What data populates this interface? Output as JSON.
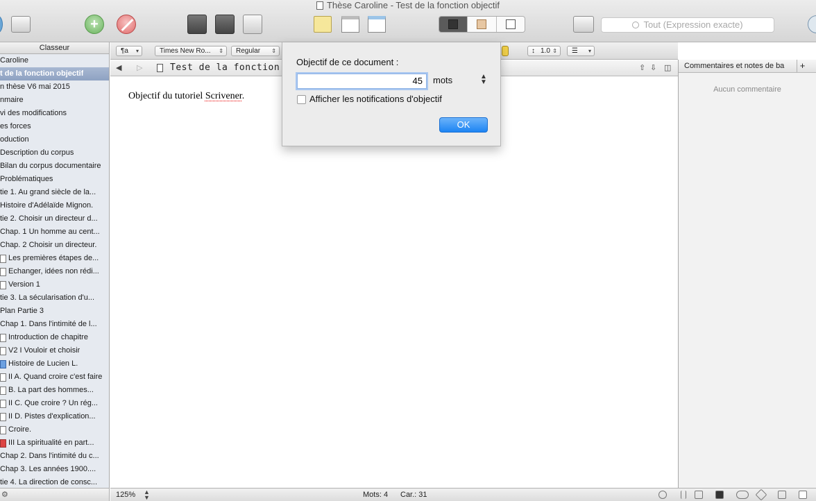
{
  "window": {
    "title": "Thèse Caroline - Test de la fonction objectif"
  },
  "toolbar": {
    "search_placeholder": "Tout (Expression exacte)"
  },
  "binder": {
    "header": "Classeur",
    "items": [
      {
        "label": "Caroline",
        "selected": false,
        "icon": "none"
      },
      {
        "label": "t de la fonction objectif",
        "selected": true,
        "icon": "none"
      },
      {
        "label": "n thèse V6 mai 2015",
        "selected": false,
        "icon": "none"
      },
      {
        "label": "nmaire",
        "selected": false,
        "icon": "none"
      },
      {
        "label": "vi des modifications",
        "selected": false,
        "icon": "none"
      },
      {
        "label": "es forces",
        "selected": false,
        "icon": "none"
      },
      {
        "label": "oduction",
        "selected": false,
        "icon": "none"
      },
      {
        "label": "Description du corpus",
        "selected": false,
        "icon": "none"
      },
      {
        "label": "Bilan du corpus documentaire",
        "selected": false,
        "icon": "none"
      },
      {
        "label": "Problématiques",
        "selected": false,
        "icon": "none"
      },
      {
        "label": "tie 1. Au grand siècle de la...",
        "selected": false,
        "icon": "none"
      },
      {
        "label": "Histoire d'Adélaïde Mignon.",
        "selected": false,
        "icon": "none"
      },
      {
        "label": "tie 2. Choisir un directeur d...",
        "selected": false,
        "icon": "none"
      },
      {
        "label": "Chap. 1 Un homme au cent...",
        "selected": false,
        "icon": "none"
      },
      {
        "label": "Chap. 2 Choisir un directeur.",
        "selected": false,
        "icon": "none"
      },
      {
        "label": "Les premières étapes de...",
        "selected": false,
        "icon": "doc"
      },
      {
        "label": "Echanger, idées non rédi...",
        "selected": false,
        "icon": "doc"
      },
      {
        "label": "Version 1",
        "selected": false,
        "icon": "doc"
      },
      {
        "label": "tie 3. La sécularisation d'u...",
        "selected": false,
        "icon": "none"
      },
      {
        "label": "Plan Partie 3",
        "selected": false,
        "icon": "none"
      },
      {
        "label": "Chap 1. Dans l'intimité de l...",
        "selected": false,
        "icon": "none"
      },
      {
        "label": "Introduction de chapitre",
        "selected": false,
        "icon": "doc"
      },
      {
        "label": "V2 I Vouloir et choisir",
        "selected": false,
        "icon": "doc"
      },
      {
        "label": "Histoire de Lucien L.",
        "selected": false,
        "icon": "blue"
      },
      {
        "label": "II A. Quand croire c'est faire",
        "selected": false,
        "icon": "doc"
      },
      {
        "label": "B. La part des hommes...",
        "selected": false,
        "icon": "doc"
      },
      {
        "label": "II C. Que croire ? Un rég...",
        "selected": false,
        "icon": "doc"
      },
      {
        "label": "II D. Pistes d'explication...",
        "selected": false,
        "icon": "doc"
      },
      {
        "label": "Croire.",
        "selected": false,
        "icon": "doc"
      },
      {
        "label": "III La spiritualité en part...",
        "selected": false,
        "icon": "red"
      },
      {
        "label": "Chap 2. Dans l'intimité du c...",
        "selected": false,
        "icon": "none"
      },
      {
        "label": "Chap 3. Les années 1900....",
        "selected": false,
        "icon": "none"
      },
      {
        "label": "tie 4. La direction de consc...",
        "selected": false,
        "icon": "none"
      }
    ]
  },
  "formatbar": {
    "style": "¶a",
    "font": "Times New Ro...",
    "weight": "Regular",
    "spacing": "1.0"
  },
  "editor": {
    "header_title": "Test de la fonction o",
    "body_before": "Objectif du tutoriel ",
    "body_spell": "Scrivener",
    "body_after": "."
  },
  "inspector": {
    "header": "Commentaires et notes de ba",
    "add_label": "+",
    "empty": "Aucun commentaire"
  },
  "footer": {
    "zoom": "125%",
    "words": "Mots: 4",
    "chars": "Car.: 31"
  },
  "dialog": {
    "label": "Objectif de ce document :",
    "value": "45",
    "unit": "mots",
    "checkbox_label": "Afficher les notifications d'objectif",
    "ok": "OK"
  },
  "colors": {
    "accent": "#1d84f3",
    "selection": "#8ea2c2",
    "binder_bg": "#e6eaf0"
  }
}
